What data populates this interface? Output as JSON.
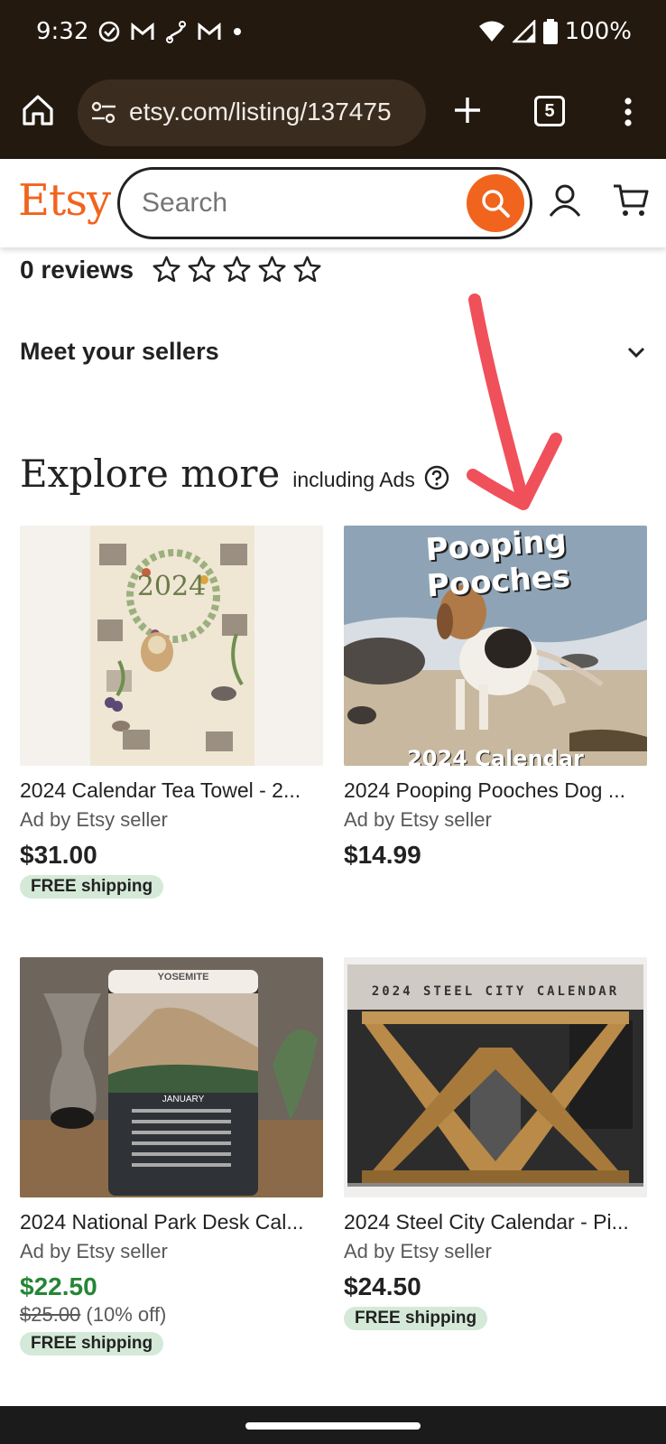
{
  "status_bar": {
    "time": "9:32",
    "battery": "100%",
    "icons": [
      "check-circle-icon",
      "gmail-icon",
      "route-icon",
      "gmail-icon",
      "dot-icon",
      "wifi-icon",
      "signal-icon",
      "battery-icon"
    ]
  },
  "browser": {
    "url": "etsy.com/listing/137475",
    "tab_count": "5"
  },
  "header": {
    "logo": "Etsy",
    "search_placeholder": "Search",
    "accent_color": "#f1641e"
  },
  "reviews": {
    "text": "0 reviews",
    "rating_stars": 0,
    "max_stars": 5
  },
  "meet_sellers": {
    "label": "Meet your sellers"
  },
  "explore": {
    "title": "Explore more",
    "subtitle": "including Ads"
  },
  "listings": [
    {
      "title": "2024 Calendar Tea Towel - 2...",
      "seller": "Ad by Etsy seller",
      "price": "$31.00",
      "original_price": "",
      "discount": "",
      "free_shipping": "FREE shipping",
      "image_text": "2024"
    },
    {
      "title": "2024 Pooping Pooches Dog ...",
      "seller": "Ad by Etsy seller",
      "price": "$14.99",
      "original_price": "",
      "discount": "",
      "free_shipping": "",
      "image_text": "Pooping Pooches",
      "image_subtext": "2024 Calendar"
    },
    {
      "title": "2024 National Park Desk Cal...",
      "seller": "Ad by Etsy seller",
      "price": "$22.50",
      "original_price": "$25.00",
      "discount": "(10% off)",
      "free_shipping": "FREE shipping",
      "image_text": "YOSEMITE",
      "image_subtext": "JANUARY"
    },
    {
      "title": "2024 Steel City Calendar - Pi...",
      "seller": "Ad by Etsy seller",
      "price": "$24.50",
      "original_price": "",
      "discount": "",
      "free_shipping": "FREE shipping",
      "image_text": "2024 STEEL CITY CALENDAR"
    }
  ],
  "colors": {
    "sale_green": "#258635",
    "free_ship_bg": "#d4e9d7",
    "annotation_red": "#f0505a"
  }
}
